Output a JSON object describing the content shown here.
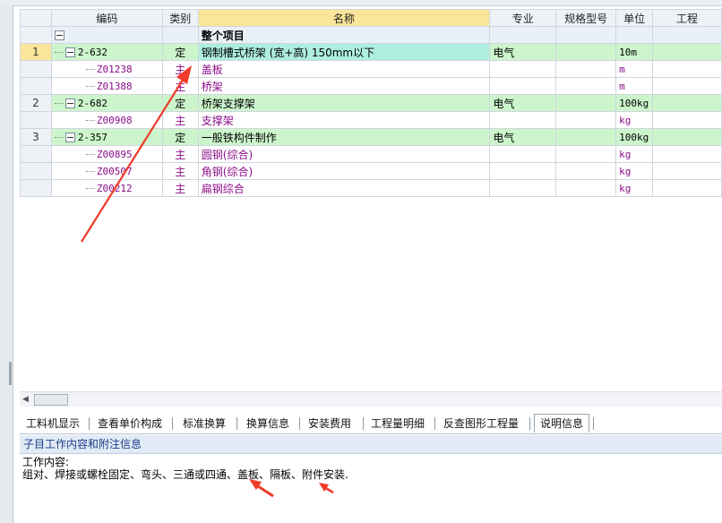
{
  "columns": {
    "code": "编码",
    "type": "类别",
    "name": "名称",
    "major": "专业",
    "spec": "规格型号",
    "unit": "单位",
    "qty": "工程"
  },
  "top_row": {
    "name": "整个项目"
  },
  "rows": [
    {
      "rn": "1",
      "code": "2-632",
      "type": "定",
      "name": "钢制槽式桥架 (宽+高) 150mm以下",
      "major": "电气",
      "unit": "10m"
    },
    {
      "code": "Z01238",
      "type": "主",
      "name": "盖板",
      "unit": "m"
    },
    {
      "code": "Z01388",
      "type": "主",
      "name": "桥架",
      "unit": "m"
    },
    {
      "rn": "2",
      "code": "2-682",
      "type": "定",
      "name": "桥架支撑架",
      "major": "电气",
      "unit": "100kg"
    },
    {
      "code": "Z00908",
      "type": "主",
      "name": "支撑架",
      "unit": "kg"
    },
    {
      "rn": "3",
      "code": "2-357",
      "type": "定",
      "name": "一般铁构件制作",
      "major": "电气",
      "unit": "100kg"
    },
    {
      "code": "Z00895",
      "type": "主",
      "name": "圆钢(综合)",
      "unit": "kg"
    },
    {
      "code": "Z00507",
      "type": "主",
      "name": "角钢(综合)",
      "unit": "kg"
    },
    {
      "code": "Z00212",
      "type": "主",
      "name": "扁钢综合",
      "unit": "kg"
    }
  ],
  "tabs": [
    "工料机显示",
    "查看单价构成",
    "标准换算",
    "换算信息",
    "安装费用",
    "工程量明细",
    "反查图形工程量",
    "说明信息"
  ],
  "panel": {
    "header": "子目工作内容和附注信息",
    "line1": "工作内容:",
    "line2": "组对、焊接或螺栓固定、弯头、三通或四通、盖板、隔板、附件安装."
  },
  "colors": {
    "main_row": "#ccf5cc",
    "selected": "#fbe59a",
    "material_text": "#8a0d8a",
    "arrow": "#f03a2a"
  }
}
